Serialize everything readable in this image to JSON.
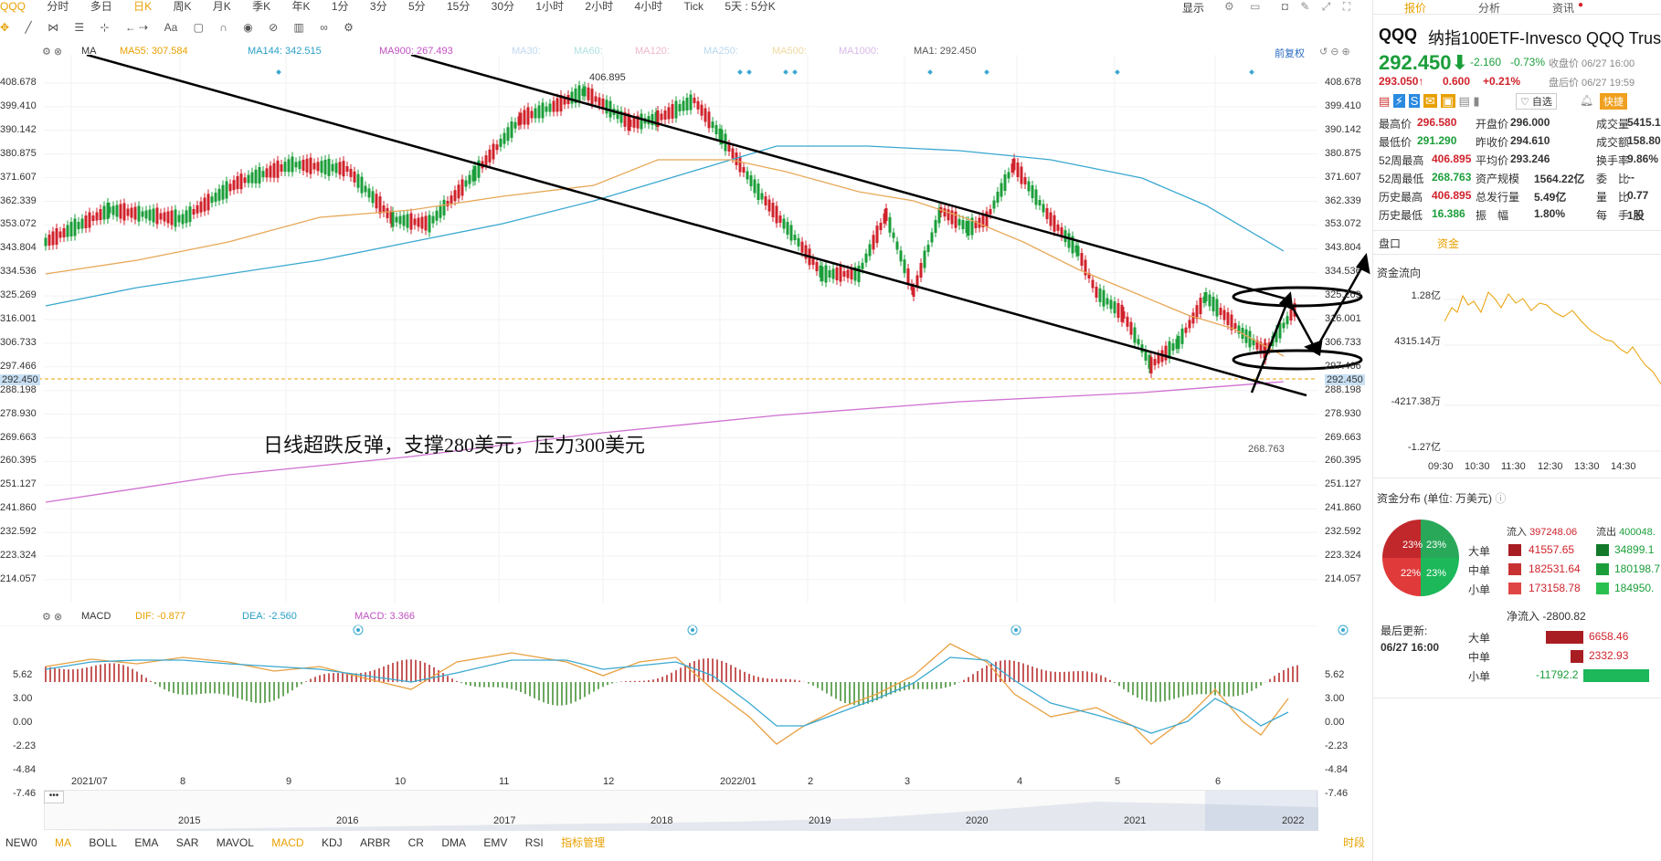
{
  "top_tabs": [
    {
      "label": "QQQ",
      "active": true
    },
    {
      "label": "分时"
    },
    {
      "label": "多日"
    },
    {
      "label": "日K",
      "active": true
    },
    {
      "label": "周K"
    },
    {
      "label": "月K"
    },
    {
      "label": "季K"
    },
    {
      "label": "年K"
    },
    {
      "label": "1分"
    },
    {
      "label": "3分"
    },
    {
      "label": "5分"
    },
    {
      "label": "15分"
    },
    {
      "label": "30分"
    },
    {
      "label": "1小时"
    },
    {
      "label": "2小时"
    },
    {
      "label": "4小时"
    },
    {
      "label": "Tick"
    },
    {
      "label": "5天 : 5分K"
    }
  ],
  "top_right": {
    "display_label": "显示"
  },
  "toolbar2": {
    "aa": "Aa"
  },
  "ma_legend": {
    "prefix": "MA",
    "ma55": "MA55: 307.584",
    "ma144": "MA144: 342.515",
    "ma900": "MA900: 267.493",
    "ma30": "MA30:",
    "ma60": "MA60:",
    "ma120": "MA120:",
    "ma250": "MA250:",
    "ma500": "MA500:",
    "ma1000": "MA1000:",
    "ma1": "MA1: 292.450",
    "fq": "前复权"
  },
  "price_axis": [
    "408.678",
    "399.410",
    "390.142",
    "380.875",
    "371.607",
    "362.339",
    "353.072",
    "343.804",
    "334.536",
    "325.269",
    "316.001",
    "306.733",
    "297.466",
    "288.198",
    "278.930",
    "269.663",
    "260.395",
    "251.127",
    "241.860",
    "232.592",
    "223.324",
    "214.057"
  ],
  "current_price_tag": "292.450",
  "annotations": {
    "high": "406.895",
    "low": "268.763",
    "note": "日线超跌反弹，支撑280美元，压力300美元"
  },
  "macd_legend": {
    "prefix": "MACD",
    "dif": "DIF: -0.877",
    "dea": "DEA: -2.560",
    "macd": "MACD: 3.366"
  },
  "macd_axis": [
    "5.62",
    "3.00",
    "0.00",
    "-2.23",
    "-4.84",
    "-7.46"
  ],
  "x_axis": [
    "2021/07",
    "8",
    "9",
    "10",
    "11",
    "12",
    "2022/01",
    "2",
    "3",
    "4",
    "5",
    "6"
  ],
  "overview_years": [
    "2015",
    "2016",
    "2017",
    "2018",
    "2019",
    "2020",
    "2021",
    "2022"
  ],
  "overview_dots": "•••",
  "bottom_tabs": [
    {
      "label": "NEW0"
    },
    {
      "label": "MA",
      "active": true
    },
    {
      "label": "BOLL"
    },
    {
      "label": "EMA"
    },
    {
      "label": "SAR"
    },
    {
      "label": "MAVOL"
    },
    {
      "label": "MACD",
      "active": true
    },
    {
      "label": "KDJ"
    },
    {
      "label": "ARBR"
    },
    {
      "label": "CR"
    },
    {
      "label": "DMA"
    },
    {
      "label": "EMV"
    },
    {
      "label": "RSI"
    },
    {
      "label": "指标管理"
    }
  ],
  "bottom_right": "时段",
  "right_panel": {
    "tabs": [
      "报价",
      "分析",
      "资讯"
    ],
    "symbol": "QQQ",
    "name": "纳指100ETF-Invesco QQQ Trust",
    "price": "292.450",
    "change": "-2.160",
    "pct": "-0.73%",
    "close_label": "收盘价 06/27 16:00",
    "after_price": "293.050",
    "after_change": "0.600",
    "after_pct": "+0.21%",
    "after_label": "盘后价 06/27 19:59",
    "fav_label": "自选",
    "quick_label": "快捷",
    "stats": [
      [
        "最高价",
        "296.580",
        "开盘价",
        "296.000",
        "成交量",
        "5415.1"
      ],
      [
        "最低价",
        "291.290",
        "昨收价",
        "294.610",
        "成交额",
        "158.80"
      ],
      [
        "52周最高",
        "406.895",
        "平均价",
        "293.246",
        "换手率",
        "9.86%"
      ],
      [
        "52周最低",
        "268.763",
        "资产规模",
        "1564.22亿",
        "委　比",
        "--"
      ],
      [
        "历史最高",
        "406.895",
        "总发行量",
        "5.49亿",
        "量　比",
        "0.77"
      ],
      [
        "历史最低",
        "16.386",
        "振　幅",
        "1.80%",
        "每　手",
        "1股"
      ]
    ],
    "sub_tabs": [
      "盘口",
      "资金"
    ],
    "flow_title": "资金流向",
    "flow_axis": [
      "1.28亿",
      "4315.14万",
      "-4217.38万",
      "-1.27亿"
    ],
    "flow_times": [
      "09:30",
      "10:30",
      "11:30",
      "12:30",
      "13:30",
      "14:30"
    ],
    "dist_title": "资金分布 (单位: 万美元)",
    "pie_labels": [
      "23%",
      "23%",
      "22%",
      "23%"
    ],
    "inflow_label": "流入",
    "inflow": "397248.06",
    "outflow_label": "流出",
    "outflow": "400048.",
    "rows": [
      [
        "大单",
        "41557.65",
        "34899.1"
      ],
      [
        "中单",
        "182531.64",
        "180198.7"
      ],
      [
        "小单",
        "173158.78",
        "184950."
      ]
    ],
    "net_label": "净流入",
    "net": "-2800.82",
    "update_label": "最后更新:",
    "update_time": "06/27 16:00",
    "net_rows": [
      [
        "大单",
        "6658.46"
      ],
      [
        "中单",
        "2332.93"
      ],
      [
        "小单",
        "-11792.2"
      ]
    ]
  }
}
